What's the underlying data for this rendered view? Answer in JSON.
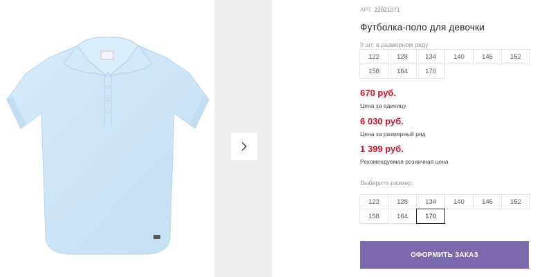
{
  "product": {
    "article_label": "АРТ.",
    "article_value": "22021071",
    "title": "Футболка-поло для девочки",
    "image_icon": "polo-shirt-image",
    "gallery_next_icon": "chevron-right-icon"
  },
  "pack": {
    "note": "9 шт. в размерном ряду",
    "sizes": [
      "122",
      "128",
      "134",
      "140",
      "146",
      "152",
      "158",
      "164",
      "170"
    ]
  },
  "prices": {
    "unit": {
      "value": "670 руб.",
      "caption": "Цена за единицу"
    },
    "pack": {
      "value": "6 030 руб.",
      "caption": "Цена за размерный ряд"
    },
    "retail": {
      "value": "1 399 руб.",
      "caption": "Рекомендуемая розничная цена"
    }
  },
  "size_select": {
    "label": "Выберите размер:",
    "sizes": [
      "122",
      "128",
      "134",
      "140",
      "146",
      "152",
      "158",
      "164",
      "170"
    ],
    "selected": "170"
  },
  "actions": {
    "order_label": "ОФОРМИТЬ ЗАКАЗ"
  },
  "colors": {
    "price": "#d0102a",
    "order_button": "#7c68ad",
    "shirt": "#cfe6f7",
    "gallery_bg": "#efefef"
  }
}
